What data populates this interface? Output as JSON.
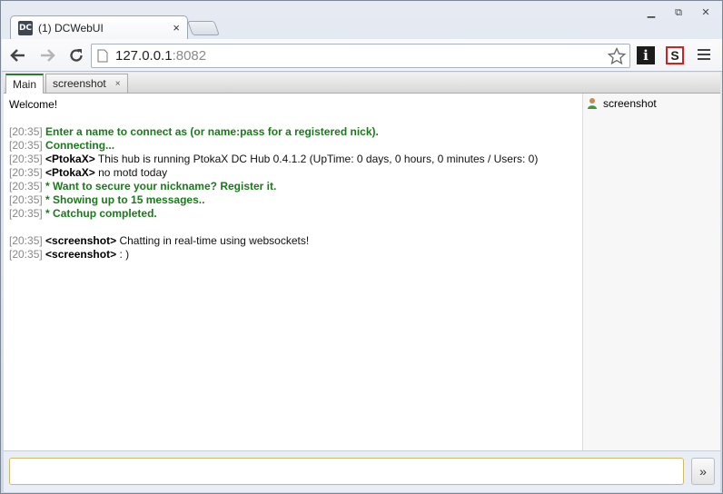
{
  "browser": {
    "tab_title": "(1) DCWebUI",
    "favicon_text": "DC",
    "tab_close": "×",
    "url_host": "127.0.0.1",
    "url_port": ":8082",
    "ext_info_label": "i",
    "ext_s_label": "S",
    "window_controls": [
      "▭",
      "⧉",
      "✕"
    ]
  },
  "app_tabs": [
    {
      "label": "Main",
      "active": true
    },
    {
      "label": "screenshot",
      "close": "×",
      "active": false
    }
  ],
  "chat": {
    "welcome": "Welcome!",
    "lines": [
      {
        "time": "[20:35]",
        "nick": "",
        "text": "Enter a name to connect as (or name:pass for a registered nick).",
        "system": true
      },
      {
        "time": "[20:35]",
        "nick": "",
        "text": "Connecting...",
        "system": true
      },
      {
        "time": "[20:35]",
        "nick": "<PtokaX>",
        "text": "This hub is running PtokaX DC Hub 0.4.1.2 (UpTime: 0 days, 0 hours, 0 minutes / Users: 0)",
        "system": false
      },
      {
        "time": "[20:35]",
        "nick": "<PtokaX>",
        "text": "no motd today",
        "system": false
      },
      {
        "time": "[20:35]",
        "nick": "",
        "text": "* Want to secure your nickname? Register it.",
        "system": true
      },
      {
        "time": "[20:35]",
        "nick": "",
        "text": "* Showing up to 15 messages..",
        "system": true
      },
      {
        "time": "[20:35]",
        "nick": "",
        "text": "* Catchup completed.",
        "system": true
      }
    ],
    "lines2": [
      {
        "time": "[20:35]",
        "nick": "<screenshot>",
        "text": "Chatting in real-time using websockets!"
      },
      {
        "time": "[20:35]",
        "nick": "<screenshot>",
        "text": ": )"
      }
    ]
  },
  "userlist": {
    "users": [
      {
        "name": "screenshot"
      }
    ]
  },
  "input": {
    "value": "",
    "send_label": "»"
  },
  "colors": {
    "system_text": "#1a7a1a",
    "timestamp": "#888888",
    "active_tab_accent": "#2c7a2c"
  }
}
